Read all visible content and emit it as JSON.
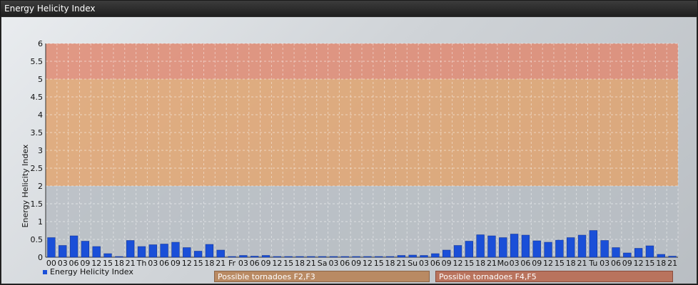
{
  "window": {
    "title": "Energy Helicity Index"
  },
  "chart_data": {
    "type": "bar",
    "title": "",
    "ylabel": "Energy Helicity Index",
    "xlabel": "",
    "ylim": [
      0,
      6
    ],
    "yticks": [
      "0",
      "0.5",
      "1",
      "1.5",
      "2",
      "2.5",
      "3",
      "3.5",
      "4",
      "4.5",
      "5",
      "5.5",
      "6"
    ],
    "grid": true,
    "legend_position": "bottom-left",
    "categories": [
      "00",
      "03",
      "06",
      "09",
      "12",
      "15",
      "18",
      "21",
      "Th",
      "03",
      "06",
      "09",
      "12",
      "15",
      "18",
      "21",
      "Fr",
      "03",
      "06",
      "09",
      "12",
      "15",
      "18",
      "21",
      "Sa",
      "03",
      "06",
      "09",
      "12",
      "15",
      "18",
      "21",
      "Su",
      "03",
      "06",
      "09",
      "12",
      "15",
      "18",
      "21",
      "Mo",
      "03",
      "06",
      "09",
      "12",
      "15",
      "18",
      "21",
      "Tu",
      "03",
      "06",
      "09",
      "12",
      "15",
      "18",
      "21"
    ],
    "series": [
      {
        "name": "Energy Helicity Index",
        "color": "#1a4fd8",
        "values": [
          0.55,
          0.33,
          0.6,
          0.45,
          0.3,
          0.1,
          0.02,
          0.47,
          0.3,
          0.35,
          0.37,
          0.42,
          0.27,
          0.17,
          0.36,
          0.2,
          0.02,
          0.05,
          0.03,
          0.05,
          0.02,
          0.02,
          0.02,
          0.02,
          0.02,
          0.02,
          0.02,
          0.02,
          0.02,
          0.02,
          0.02,
          0.05,
          0.06,
          0.05,
          0.1,
          0.2,
          0.33,
          0.45,
          0.63,
          0.6,
          0.55,
          0.65,
          0.62,
          0.46,
          0.42,
          0.48,
          0.55,
          0.62,
          0.75,
          0.47,
          0.27,
          0.12,
          0.25,
          0.32,
          0.08,
          0.03
        ]
      }
    ],
    "bands": [
      {
        "from": 0,
        "to": 2,
        "color": "#b7bdc3",
        "label": ""
      },
      {
        "from": 2,
        "to": 5,
        "color": "#dfa370",
        "label": "Possible tornadoes F2,F3"
      },
      {
        "from": 5,
        "to": 6,
        "color": "#df8a72",
        "label": "Possible tornadoes F4,F5"
      }
    ]
  }
}
